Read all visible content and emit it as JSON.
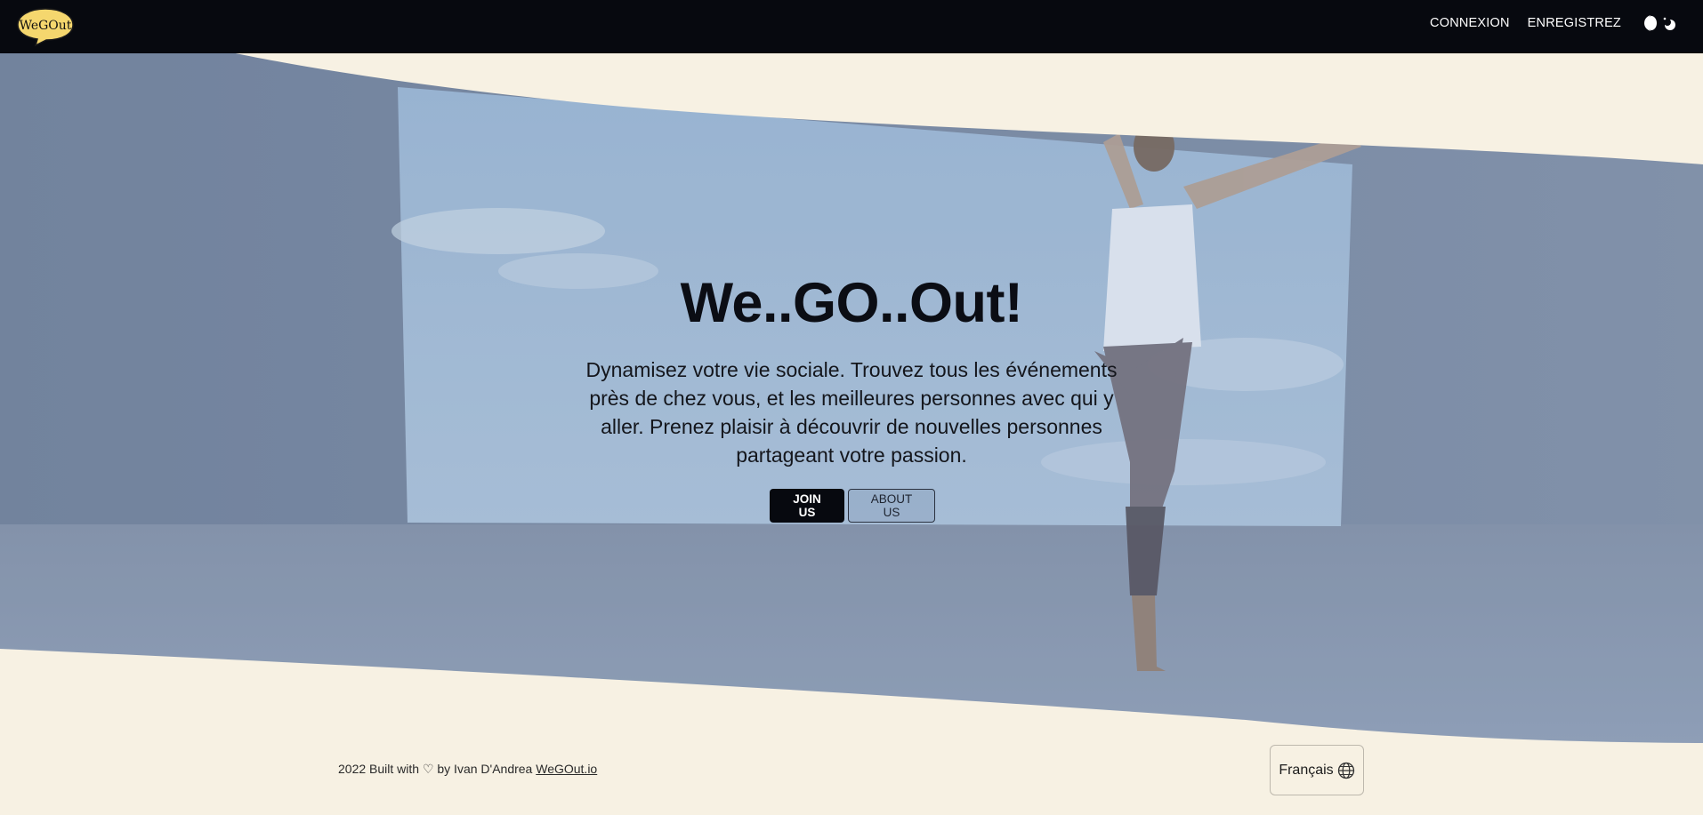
{
  "nav": {
    "logo_text": "WeGOut",
    "links": [
      "CONNEXION",
      "ENREGISTREZ"
    ],
    "theme_icon": "moon-toggle-icon"
  },
  "hero": {
    "title": "We..GO..Out!",
    "text": "Dynamisez votre vie sociale. Trouvez tous les événements près de chez vous, et les meilleures personnes avec qui y aller. Prenez plaisir à découvrir de nouvelles personnes partageant votre passion.",
    "primary_button": "JOIN US",
    "secondary_button": "ABOUT US"
  },
  "footer": {
    "prefix": "2022 Built with ♡ by Ivan D'Andrea ",
    "link": "WeGOut.io",
    "language": "Français",
    "language_icon": "globe-icon"
  },
  "colors": {
    "nav_bg": "#07090f",
    "page_bg": "#f7f1e3",
    "hero_tint": "#8ea3c0"
  }
}
